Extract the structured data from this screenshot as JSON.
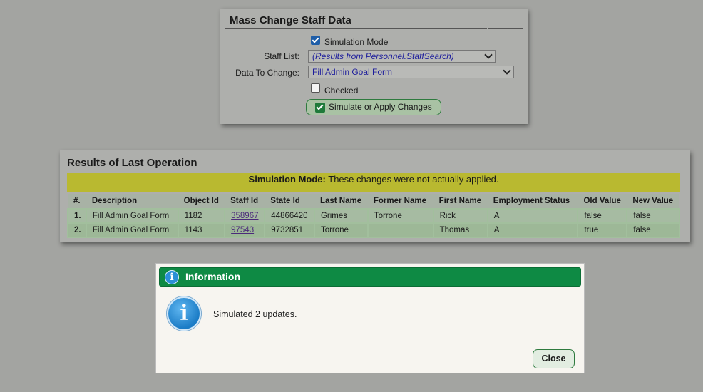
{
  "mass_change": {
    "title": "Mass Change Staff Data",
    "simulation_mode_label": "Simulation Mode",
    "simulation_mode_checked": true,
    "staff_list_label": "Staff List:",
    "staff_list_value": "(Results from Personnel.StaffSearch)",
    "data_to_change_label": "Data To Change:",
    "data_to_change_value": "Fill Admin Goal Form",
    "checked_label": "Checked",
    "checked_value": false,
    "apply_button_label": "Simulate or Apply Changes"
  },
  "results": {
    "title": "Results of Last Operation",
    "banner_bold": "Simulation Mode:",
    "banner_text": " These changes were not actually applied.",
    "columns": [
      "#.",
      "Description",
      "Object Id",
      "Staff Id",
      "State Id",
      "Last Name",
      "Former Name",
      "First Name",
      "Employment Status",
      "Old Value",
      "New Value"
    ],
    "rows": [
      {
        "num": "1.",
        "description": "Fill Admin Goal Form",
        "object_id": "1182",
        "staff_id": "358967",
        "state_id": "44866420",
        "last_name": "Grimes",
        "former_name": "Torrone",
        "first_name": "Rick",
        "employment_status": "A",
        "old_value": "false",
        "new_value": "false"
      },
      {
        "num": "2.",
        "description": "Fill Admin Goal Form",
        "object_id": "1143",
        "staff_id": "97543",
        "state_id": "9732851",
        "last_name": "Torrone",
        "former_name": "",
        "first_name": "Thomas",
        "employment_status": "A",
        "old_value": "true",
        "new_value": "false"
      }
    ]
  },
  "dialog": {
    "title": "Information",
    "message": "Simulated 2 updates.",
    "close_label": "Close",
    "icon": "info-icon",
    "header_color": "#0e8a44"
  }
}
